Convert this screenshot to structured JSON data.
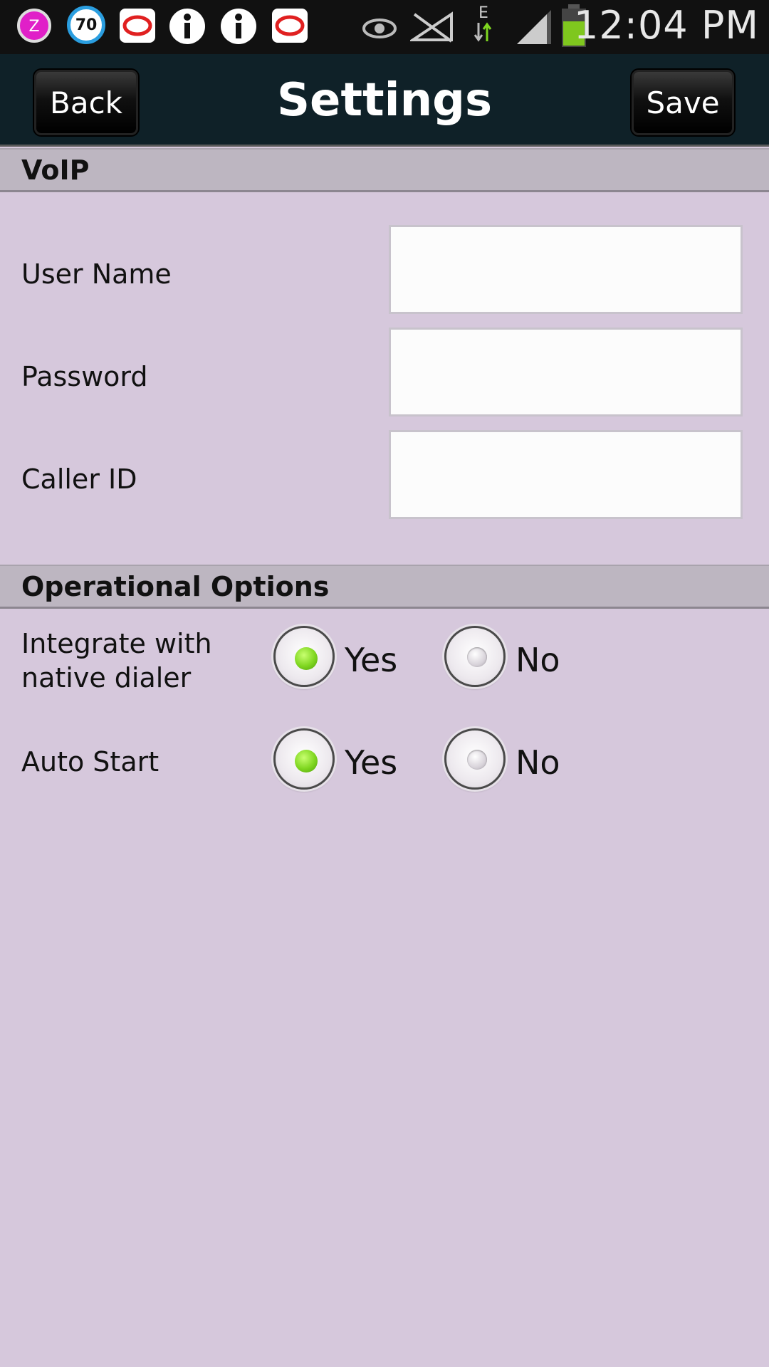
{
  "status_bar": {
    "time": "12:04 PM",
    "badge_number": "70",
    "network_type": "E",
    "icons": [
      "zello-icon",
      "speed-badge-icon",
      "messaging-icon",
      "info-icon",
      "info-icon",
      "messaging-icon",
      "eye-icon",
      "no-signal-icon",
      "data-arrows-icon",
      "signal-bars-icon",
      "battery-icon"
    ]
  },
  "header": {
    "title": "Settings",
    "back_label": "Back",
    "save_label": "Save"
  },
  "sections": {
    "voip": {
      "title": "VoIP",
      "fields": [
        {
          "label": "User Name",
          "value": ""
        },
        {
          "label": "Password",
          "value": ""
        },
        {
          "label": "Caller ID",
          "value": ""
        }
      ]
    },
    "operational": {
      "title": "Operational Options",
      "options": [
        {
          "label_line1": "Integrate with",
          "label_line2": "native dialer",
          "yes": "Yes",
          "no": "No",
          "selected": "Yes"
        },
        {
          "label_line1": "Auto Start",
          "yes": "Yes",
          "no": "No",
          "selected": "Yes"
        }
      ]
    }
  },
  "colors": {
    "background": "#d6c8dc",
    "titlebar": "#0f2128",
    "section_header": "#bdb6c1",
    "radio_selected": "#7fd620"
  }
}
